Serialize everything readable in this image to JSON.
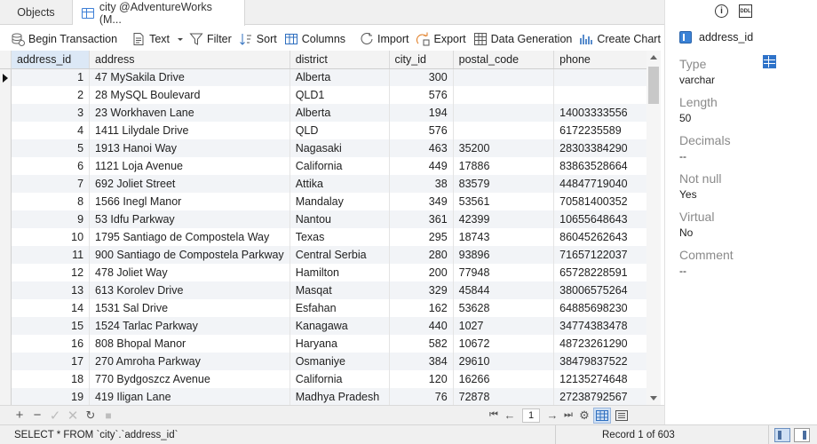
{
  "tabs": [
    {
      "label": "Objects"
    },
    {
      "label": "city @AdventureWorks (M..."
    }
  ],
  "toolbar": {
    "begin_transaction": "Begin Transaction",
    "text": "Text",
    "filter": "Filter",
    "sort": "Sort",
    "columns": "Columns",
    "import": "Import",
    "export": "Export",
    "data_generation": "Data Generation",
    "create_chart": "Create Chart"
  },
  "grid": {
    "columns": [
      "address_id",
      "address",
      "district",
      "city_id",
      "postal_code",
      "phone"
    ],
    "rows": [
      [
        "1",
        "47 MySakila Drive",
        "Alberta",
        "300",
        "",
        ""
      ],
      [
        "2",
        "28 MySQL Boulevard",
        "QLD1",
        "576",
        "",
        ""
      ],
      [
        "3",
        "23 Workhaven Lane",
        "Alberta",
        "194",
        "",
        "14003333556"
      ],
      [
        "4",
        "1411 Lilydale Drive",
        "QLD",
        "576",
        "",
        "6172235589"
      ],
      [
        "5",
        "1913 Hanoi Way",
        "Nagasaki",
        "463",
        "35200",
        "28303384290"
      ],
      [
        "6",
        "1121 Loja Avenue",
        "California",
        "449",
        "17886",
        "83863528664"
      ],
      [
        "7",
        "692 Joliet Street",
        "Attika",
        "38",
        "83579",
        "44847719040"
      ],
      [
        "8",
        "1566 Inegl Manor",
        "Mandalay",
        "349",
        "53561",
        "70581400352"
      ],
      [
        "9",
        "53 Idfu Parkway",
        "Nantou",
        "361",
        "42399",
        "10655648643"
      ],
      [
        "10",
        "1795 Santiago de Compostela Way",
        "Texas",
        "295",
        "18743",
        "86045262643"
      ],
      [
        "11",
        "900 Santiago de Compostela Parkway",
        "Central Serbia",
        "280",
        "93896",
        "71657122037"
      ],
      [
        "12",
        "478 Joliet Way",
        "Hamilton",
        "200",
        "77948",
        "65728228591"
      ],
      [
        "13",
        "613 Korolev Drive",
        "Masqat",
        "329",
        "45844",
        "38006575264"
      ],
      [
        "14",
        "1531 Sal Drive",
        "Esfahan",
        "162",
        "53628",
        "64885698230"
      ],
      [
        "15",
        "1524 Tarlac Parkway",
        "Kanagawa",
        "440",
        "1027",
        "34774383478"
      ],
      [
        "16",
        "808 Bhopal Manor",
        "Haryana",
        "582",
        "10672",
        "48723261290"
      ],
      [
        "17",
        "270 Amroha Parkway",
        "Osmaniye",
        "384",
        "29610",
        "38479837522"
      ],
      [
        "18",
        "770 Bydgoszcz Avenue",
        "California",
        "120",
        "16266",
        "12135274648"
      ],
      [
        "19",
        "419 Iligan Lane",
        "Madhya Pradesh",
        "76",
        "72878",
        "27238792567"
      ]
    ]
  },
  "pager": {
    "page": "1"
  },
  "status": {
    "sql": "SELECT * FROM `city`.`address_id`",
    "record": "Record 1 of 603"
  },
  "panel": {
    "field_name": "address_id",
    "props": [
      {
        "label": "Type",
        "value": "varchar"
      },
      {
        "label": "Length",
        "value": "50"
      },
      {
        "label": "Decimals",
        "value": "--"
      },
      {
        "label": "Not null",
        "value": "Yes"
      },
      {
        "label": "Virtual",
        "value": "No"
      },
      {
        "label": "Comment",
        "value": "--"
      }
    ],
    "ddl_icon_text": "DDL"
  }
}
